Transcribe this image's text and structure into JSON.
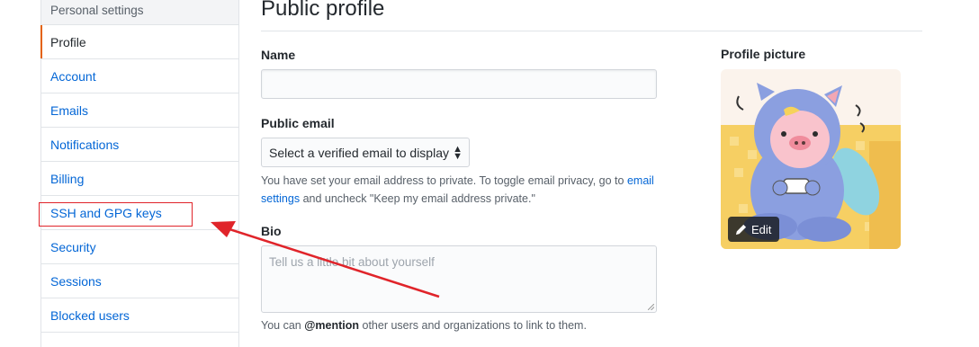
{
  "sidebar": {
    "header": "Personal settings",
    "items": [
      {
        "label": "Profile"
      },
      {
        "label": "Account"
      },
      {
        "label": "Emails"
      },
      {
        "label": "Notifications"
      },
      {
        "label": "Billing"
      },
      {
        "label": "SSH and GPG keys"
      },
      {
        "label": "Security"
      },
      {
        "label": "Sessions"
      },
      {
        "label": "Blocked users"
      }
    ],
    "selected": "Profile"
  },
  "main": {
    "title": "Public profile",
    "name": {
      "label": "Name",
      "value": ""
    },
    "public_email": {
      "label": "Public email",
      "selected": "Select a verified email to display",
      "note_before": "You have set your email address to private. To toggle email privacy, go to ",
      "note_link": "email settings",
      "note_after": " and uncheck \"Keep my email address private.\""
    },
    "bio": {
      "label": "Bio",
      "placeholder": "Tell us a little bit about yourself",
      "note_before": "You can ",
      "note_mention": "@mention",
      "note_after": " other users and organizations to link to them."
    },
    "profile_picture": {
      "label": "Profile picture",
      "edit_label": "Edit"
    }
  },
  "annotations": {
    "highlight_color": "#e0242a"
  },
  "colors": {
    "link": "#0366d6",
    "selected_accent": "#e36209",
    "border": "#e1e4e8"
  }
}
